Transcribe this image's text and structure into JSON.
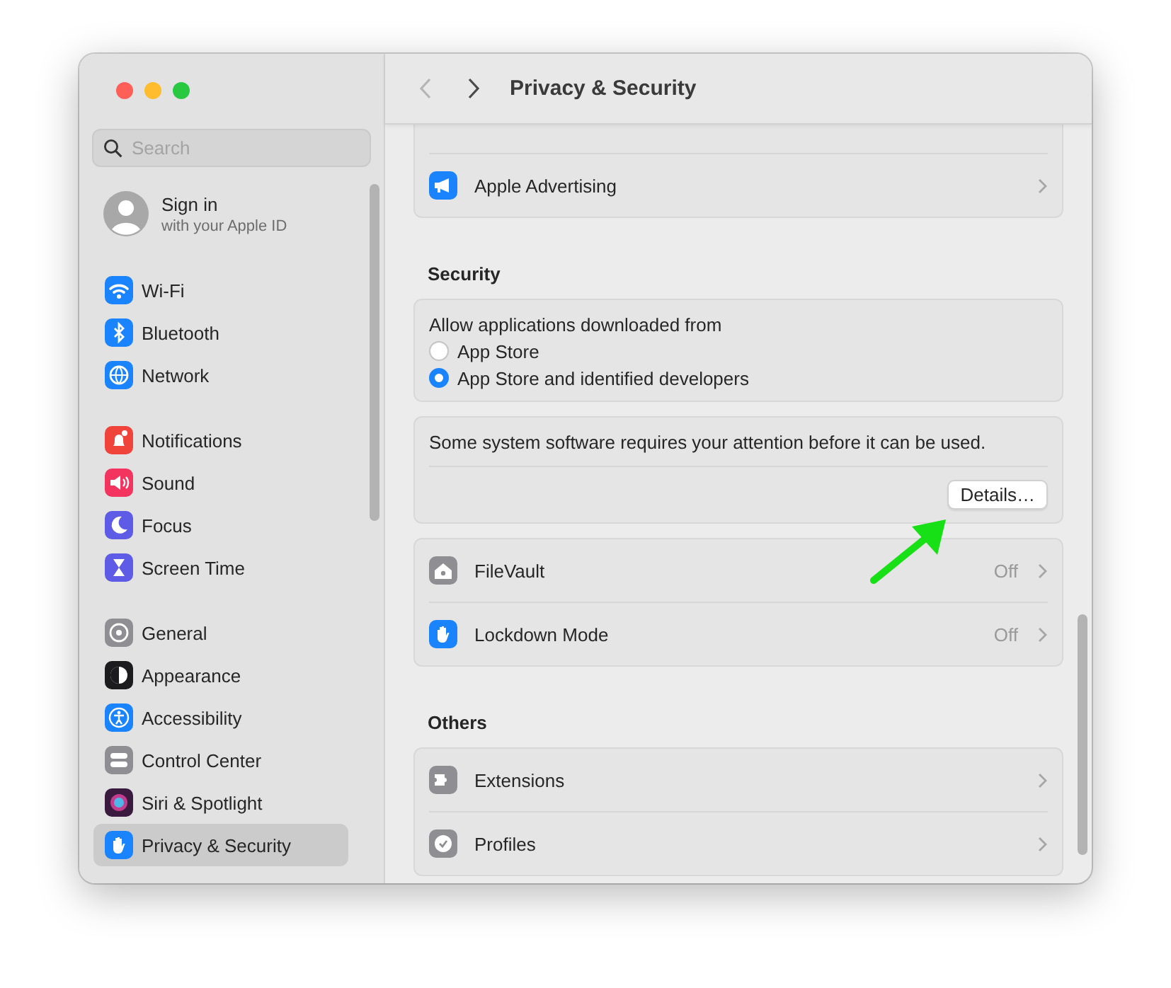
{
  "window": {
    "title": "Privacy & Security"
  },
  "sidebar": {
    "search": {
      "placeholder": "Search"
    },
    "account": {
      "title": "Sign in",
      "subtitle": "with your Apple ID"
    },
    "groups": [
      [
        {
          "label": "Wi-Fi",
          "selected": false
        },
        {
          "label": "Bluetooth",
          "selected": false
        },
        {
          "label": "Network",
          "selected": false
        }
      ],
      [
        {
          "label": "Notifications",
          "selected": false
        },
        {
          "label": "Sound",
          "selected": false
        },
        {
          "label": "Focus",
          "selected": false
        },
        {
          "label": "Screen Time",
          "selected": false
        }
      ],
      [
        {
          "label": "General",
          "selected": false
        },
        {
          "label": "Appearance",
          "selected": false
        },
        {
          "label": "Accessibility",
          "selected": false
        },
        {
          "label": "Control Center",
          "selected": false
        },
        {
          "label": "Siri & Spotlight",
          "selected": false
        },
        {
          "label": "Privacy & Security",
          "selected": true
        }
      ]
    ]
  },
  "sections": [
    {
      "cards": [
        {
          "kind": "partial_rows",
          "rows": [
            {
              "label": "Apple Advertising"
            }
          ]
        }
      ]
    },
    {
      "heading": "Security",
      "cards": [
        {
          "kind": "radio",
          "title": "Allow applications downloaded from",
          "options": [
            {
              "label": "App Store",
              "selected": false
            },
            {
              "label": "App Store and identified developers",
              "selected": true
            }
          ]
        },
        {
          "kind": "notice",
          "text": "Some system software requires your attention before it can be used.",
          "button": "Details…"
        },
        {
          "kind": "rows",
          "rows": [
            {
              "label": "FileVault",
              "value": "Off"
            },
            {
              "label": "Lockdown Mode",
              "value": "Off"
            }
          ]
        }
      ]
    },
    {
      "heading": "Others",
      "cards": [
        {
          "kind": "rows",
          "rows": [
            {
              "label": "Extensions"
            },
            {
              "label": "Profiles"
            }
          ]
        }
      ]
    }
  ],
  "annotation": {
    "kind": "arrow"
  }
}
